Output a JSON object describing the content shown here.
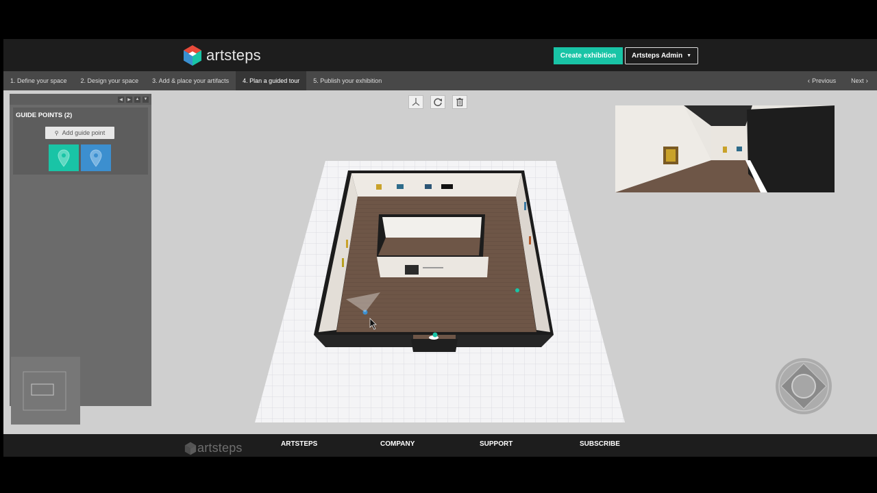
{
  "header": {
    "brand": "artsteps",
    "create_button": "Create exhibition",
    "account_button": "Artsteps Admin"
  },
  "steps": [
    {
      "label": "1. Define your space",
      "active": false
    },
    {
      "label": "2. Design your space",
      "active": false
    },
    {
      "label": "3. Add & place your artifacts",
      "active": false
    },
    {
      "label": "4. Plan a guided tour",
      "active": true
    },
    {
      "label": "5. Publish your exhibition",
      "active": false
    }
  ],
  "nav": {
    "previous": "Previous",
    "next": "Next"
  },
  "guide_panel": {
    "title": "GUIDE POINTS (2)",
    "add_button": "Add guide point",
    "points": [
      {
        "color": "#19c4a6"
      },
      {
        "color": "#3c8fcf"
      }
    ]
  },
  "toolbar": {
    "icons": [
      "axes-icon",
      "rotate-icon",
      "trash-icon"
    ]
  },
  "footer": {
    "brand": "artsteps",
    "links": [
      "ARTSTEPS",
      "COMPANY",
      "SUPPORT",
      "SUBSCRIBE"
    ]
  },
  "colors": {
    "accent": "#19c4a6",
    "secondary": "#3c8fcf",
    "header_bg": "#1d1d1d",
    "steps_bg": "#484848",
    "floor": "#6b5446"
  }
}
